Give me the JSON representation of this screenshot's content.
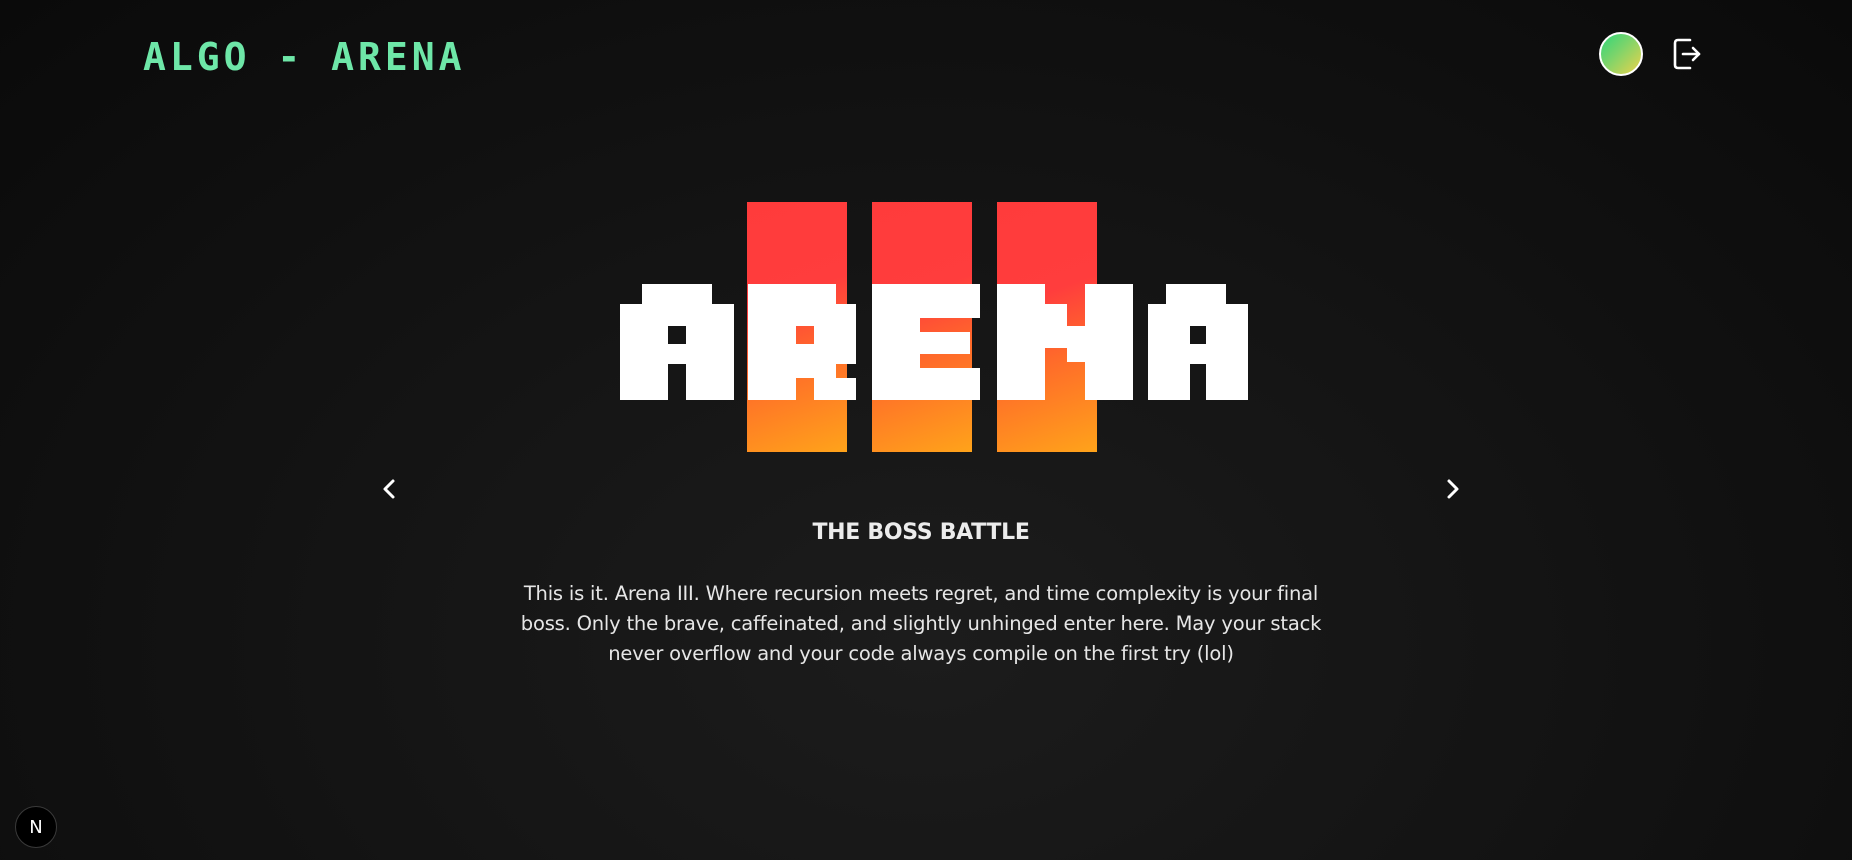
{
  "header": {
    "logo_text": "ALGO - ARENA",
    "logo_color": "#6ee7a8"
  },
  "user": {
    "avatar_icon": "avatar-gradient",
    "logout_icon": "logout-icon"
  },
  "slide": {
    "hero_word": "ARENA",
    "hero_accent_colors": [
      "#ff3b3b",
      "#ffa31a"
    ],
    "title": "THE BOSS BATTLE",
    "description": "This is it. Arena III. Where recursion meets regret, and time complexity is your final boss. Only the brave, caffeinated, and slightly unhinged enter here. May your stack never overflow and your code always compile on the first try (lol)",
    "prev_icon": "chevron-left-icon",
    "next_icon": "chevron-right-icon"
  },
  "dev_badge": {
    "label": "N"
  }
}
